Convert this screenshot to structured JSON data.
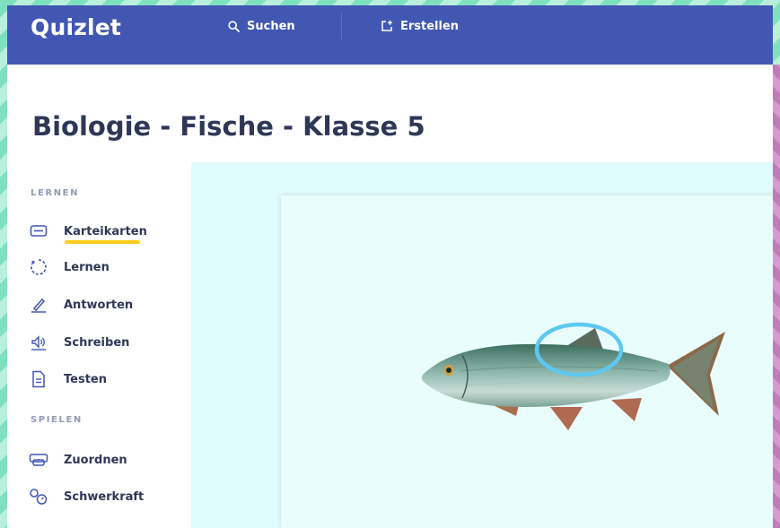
{
  "header": {
    "logo": "Quizlet",
    "search_label": "Suchen",
    "create_label": "Erstellen"
  },
  "page": {
    "title": "Biologie - Fische - Klasse 5"
  },
  "sidebar": {
    "learn_section": "LERNEN",
    "learn_items": [
      {
        "label": "Karteikarten",
        "icon": "flashcards-icon",
        "active": true
      },
      {
        "label": "Lernen",
        "icon": "learn-cycle-icon"
      },
      {
        "label": "Antworten",
        "icon": "pen-icon"
      },
      {
        "label": "Schreiben",
        "icon": "speaker-icon"
      },
      {
        "label": "Testen",
        "icon": "test-document-icon"
      }
    ],
    "play_section": "SPIELEN",
    "play_items": [
      {
        "label": "Zuordnen",
        "icon": "match-icon"
      },
      {
        "label": "Schwerkraft",
        "icon": "gravity-icon"
      }
    ]
  },
  "colors": {
    "brand": "#4257b2",
    "active_underline": "#ffcd1f",
    "highlight_circle": "#5ec8f0",
    "stage_bg": "#e1fcfc"
  },
  "flashcard": {
    "image": "fish-image",
    "highlight": "dorsal-fin-highlight"
  }
}
